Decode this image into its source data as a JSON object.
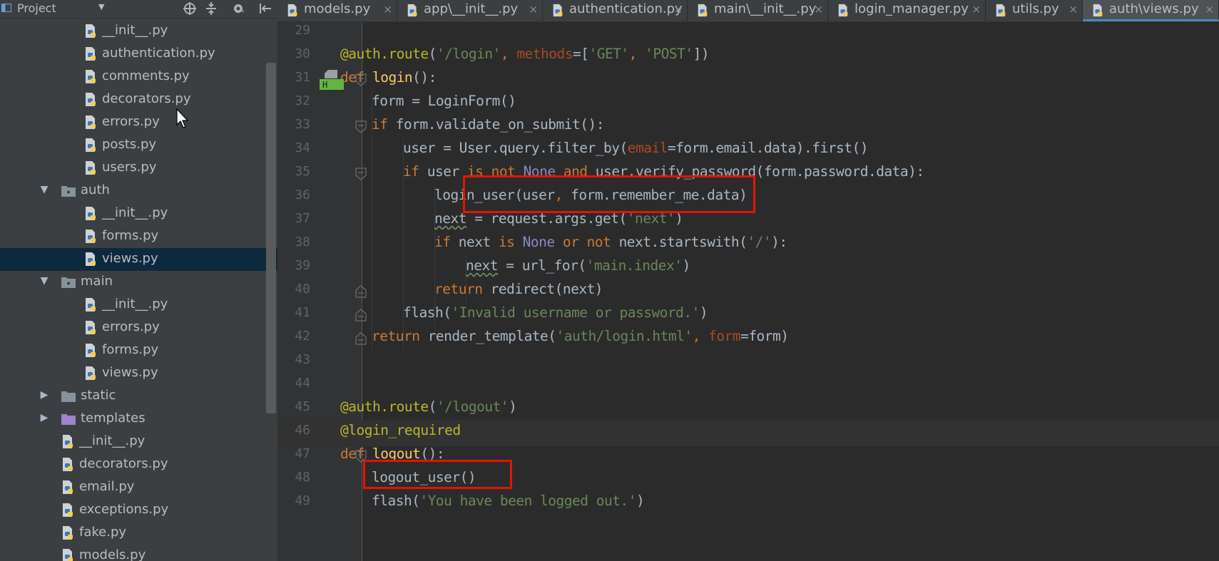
{
  "sidebar": {
    "title": "Project",
    "dropdown_glyph": "▼",
    "icons": {
      "project": "project-icon",
      "locate": "locate-icon",
      "collapse": "collapse-all-icon",
      "settings": "gear-icon",
      "hide": "hide-panel-icon"
    },
    "items": [
      {
        "label": "__init__.py",
        "type": "python-file",
        "indent": 3
      },
      {
        "label": "authentication.py",
        "type": "python-file",
        "indent": 3
      },
      {
        "label": "comments.py",
        "type": "python-file",
        "indent": 3
      },
      {
        "label": "decorators.py",
        "type": "python-file",
        "indent": 3
      },
      {
        "label": "errors.py",
        "type": "python-file",
        "indent": 3
      },
      {
        "label": "posts.py",
        "type": "python-file",
        "indent": 3
      },
      {
        "label": "users.py",
        "type": "python-file",
        "indent": 3
      },
      {
        "label": "auth",
        "type": "package",
        "indent": 2,
        "expanded": true
      },
      {
        "label": "__init__.py",
        "type": "python-file",
        "indent": 3
      },
      {
        "label": "forms.py",
        "type": "python-file",
        "indent": 3
      },
      {
        "label": "views.py",
        "type": "python-file",
        "indent": 3,
        "selected": true
      },
      {
        "label": "main",
        "type": "package",
        "indent": 2,
        "expanded": true
      },
      {
        "label": "__init__.py",
        "type": "python-file",
        "indent": 3
      },
      {
        "label": "errors.py",
        "type": "python-file",
        "indent": 3
      },
      {
        "label": "forms.py",
        "type": "python-file",
        "indent": 3
      },
      {
        "label": "views.py",
        "type": "python-file",
        "indent": 3
      },
      {
        "label": "static",
        "type": "folder",
        "indent": 2,
        "expanded": false
      },
      {
        "label": "templates",
        "type": "template-folder",
        "indent": 2,
        "expanded": false
      },
      {
        "label": "__init__.py",
        "type": "python-file",
        "indent": 2
      },
      {
        "label": "decorators.py",
        "type": "python-file",
        "indent": 2
      },
      {
        "label": "email.py",
        "type": "python-file",
        "indent": 2
      },
      {
        "label": "exceptions.py",
        "type": "python-file",
        "indent": 2
      },
      {
        "label": "fake.py",
        "type": "python-file",
        "indent": 2
      },
      {
        "label": "models.py",
        "type": "python-file",
        "indent": 2
      }
    ]
  },
  "tabs": [
    {
      "label": "models.py",
      "close": "×"
    },
    {
      "label": "app\\__init__.py",
      "close": "×"
    },
    {
      "label": "authentication.py",
      "close": "×"
    },
    {
      "label": "main\\__init__.py",
      "close": "×"
    },
    {
      "label": "login_manager.py",
      "close": "×"
    },
    {
      "label": "utils.py",
      "close": "×"
    },
    {
      "label": "auth\\views.py",
      "close": "×",
      "active": true
    }
  ],
  "editor": {
    "colors": {
      "keyword": "#cc7832",
      "string": "#6a8759",
      "decorator": "#bbb529",
      "function": "#ffc66d",
      "constant": "#8888c6",
      "param": "#aa4926",
      "text": "#a9b7c6",
      "highlight": "#e51400"
    },
    "lines": [
      {
        "n": "29",
        "indent": 0,
        "tokens": []
      },
      {
        "n": "30",
        "indent": 0,
        "tokens": [
          [
            "dec",
            "@auth.route"
          ],
          [
            "t",
            "("
          ],
          [
            "str",
            "'/login'"
          ],
          [
            "kw",
            ", "
          ],
          [
            "prm",
            "methods"
          ],
          [
            "t",
            "=["
          ],
          [
            "str",
            "'GET'"
          ],
          [
            "kw",
            ", "
          ],
          [
            "str",
            "'POST'"
          ],
          [
            "t",
            "])"
          ]
        ]
      },
      {
        "n": "31",
        "indent": 0,
        "tokens": [
          [
            "kw",
            "def "
          ],
          [
            "fn",
            "login"
          ],
          [
            "t",
            "():"
          ]
        ]
      },
      {
        "n": "32",
        "indent": 1,
        "tokens": [
          [
            "t",
            "form = LoginForm()"
          ]
        ]
      },
      {
        "n": "33",
        "indent": 1,
        "tokens": [
          [
            "kw",
            "if "
          ],
          [
            "t",
            "form.validate_on_submit():"
          ]
        ]
      },
      {
        "n": "34",
        "indent": 2,
        "tokens": [
          [
            "t",
            "user = User.query.filter_by("
          ],
          [
            "prm",
            "email"
          ],
          [
            "t",
            "=form.email.data).first()"
          ]
        ]
      },
      {
        "n": "35",
        "indent": 2,
        "tokens": [
          [
            "kw",
            "if "
          ],
          [
            "t",
            "user "
          ],
          [
            "kw",
            "is not "
          ],
          [
            "cst",
            "None "
          ],
          [
            "kw",
            "and "
          ],
          [
            "t",
            "user.verify_password(form.password.data):"
          ]
        ]
      },
      {
        "n": "36",
        "indent": 3,
        "tokens": [
          [
            "t",
            "login_user(user"
          ],
          [
            "kw",
            ", "
          ],
          [
            "t",
            "form.remember_me.data)"
          ]
        ]
      },
      {
        "n": "37",
        "indent": 3,
        "tokens": [
          [
            "wv",
            "next"
          ],
          [
            "t",
            " = request.args.get("
          ],
          [
            "str",
            "'next'"
          ],
          [
            "t",
            ")"
          ]
        ]
      },
      {
        "n": "38",
        "indent": 3,
        "tokens": [
          [
            "kw",
            "if "
          ],
          [
            "t",
            "next "
          ],
          [
            "kw",
            "is "
          ],
          [
            "cst",
            "None "
          ],
          [
            "kw",
            "or not "
          ],
          [
            "t",
            "next.startswith("
          ],
          [
            "str",
            "'/'"
          ],
          [
            "t",
            "):"
          ]
        ]
      },
      {
        "n": "39",
        "indent": 4,
        "tokens": [
          [
            "wv",
            "next"
          ],
          [
            "t",
            " = url_for("
          ],
          [
            "str",
            "'main.index'"
          ],
          [
            "t",
            ")"
          ]
        ]
      },
      {
        "n": "40",
        "indent": 3,
        "tokens": [
          [
            "kw",
            "return "
          ],
          [
            "t",
            "redirect(next)"
          ]
        ]
      },
      {
        "n": "41",
        "indent": 2,
        "tokens": [
          [
            "t",
            "flash("
          ],
          [
            "str",
            "'Invalid username or password.'"
          ],
          [
            "t",
            ")"
          ]
        ]
      },
      {
        "n": "42",
        "indent": 1,
        "tokens": [
          [
            "kw",
            "return "
          ],
          [
            "t",
            "render_template("
          ],
          [
            "str",
            "'auth/login.html'"
          ],
          [
            "kw",
            ", "
          ],
          [
            "prm",
            "form"
          ],
          [
            "t",
            "=form)"
          ]
        ]
      },
      {
        "n": "43",
        "indent": 0,
        "tokens": []
      },
      {
        "n": "44",
        "indent": 0,
        "tokens": []
      },
      {
        "n": "45",
        "indent": 0,
        "tokens": [
          [
            "dec",
            "@auth.route"
          ],
          [
            "t",
            "("
          ],
          [
            "str",
            "'/logout'"
          ],
          [
            "t",
            ")"
          ]
        ]
      },
      {
        "n": "46",
        "indent": 0,
        "caret": true,
        "tokens": [
          [
            "dec",
            "@login_required"
          ]
        ]
      },
      {
        "n": "47",
        "indent": 0,
        "tokens": [
          [
            "kw",
            "def "
          ],
          [
            "fn",
            "logout"
          ],
          [
            "t",
            "():"
          ]
        ]
      },
      {
        "n": "48",
        "indent": 1,
        "tokens": [
          [
            "t",
            "logout_user()"
          ]
        ]
      },
      {
        "n": "49",
        "indent": 1,
        "tokens": [
          [
            "t",
            "flash("
          ],
          [
            "str",
            "'You have been logged out.'"
          ],
          [
            "t",
            ")"
          ]
        ]
      }
    ],
    "gutter_marker": "H"
  }
}
